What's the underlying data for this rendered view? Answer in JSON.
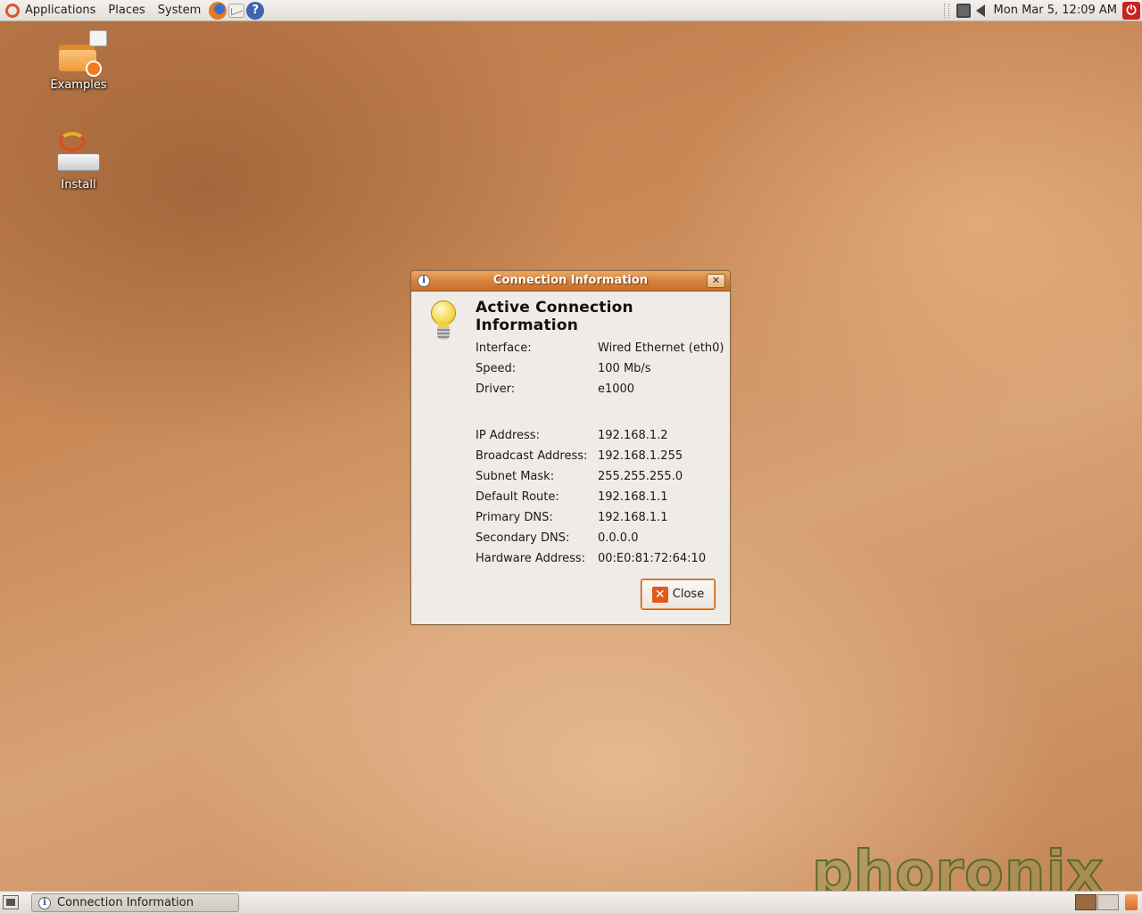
{
  "top_panel": {
    "menus": [
      "Applications",
      "Places",
      "System"
    ],
    "clock": "Mon Mar  5, 12:09 AM"
  },
  "desktop": {
    "icons": [
      {
        "label": "Examples"
      },
      {
        "label": "Install"
      }
    ],
    "watermark": "phoronix"
  },
  "dialog": {
    "title": "Connection Information",
    "heading": "Active Connection Information",
    "rows": [
      {
        "label": "Interface:",
        "value": "Wired Ethernet (eth0)"
      },
      {
        "label": "Speed:",
        "value": "100 Mb/s"
      },
      {
        "label": "Driver:",
        "value": "e1000"
      },
      {
        "label": "IP Address:",
        "value": "192.168.1.2"
      },
      {
        "label": "Broadcast Address:",
        "value": "192.168.1.255"
      },
      {
        "label": "Subnet Mask:",
        "value": "255.255.255.0"
      },
      {
        "label": "Default Route:",
        "value": "192.168.1.1"
      },
      {
        "label": "Primary DNS:",
        "value": "192.168.1.1"
      },
      {
        "label": "Secondary DNS:",
        "value": "0.0.0.0"
      },
      {
        "label": "Hardware Address:",
        "value": "00:E0:81:72:64:10"
      }
    ],
    "close_label": "Close"
  },
  "bottom_panel": {
    "tasks": [
      {
        "label": "Connection Information"
      }
    ]
  },
  "colors": {
    "titlebar": "#d5803a",
    "dialog_bg": "#efebe7",
    "accent": "#e05a1a"
  }
}
